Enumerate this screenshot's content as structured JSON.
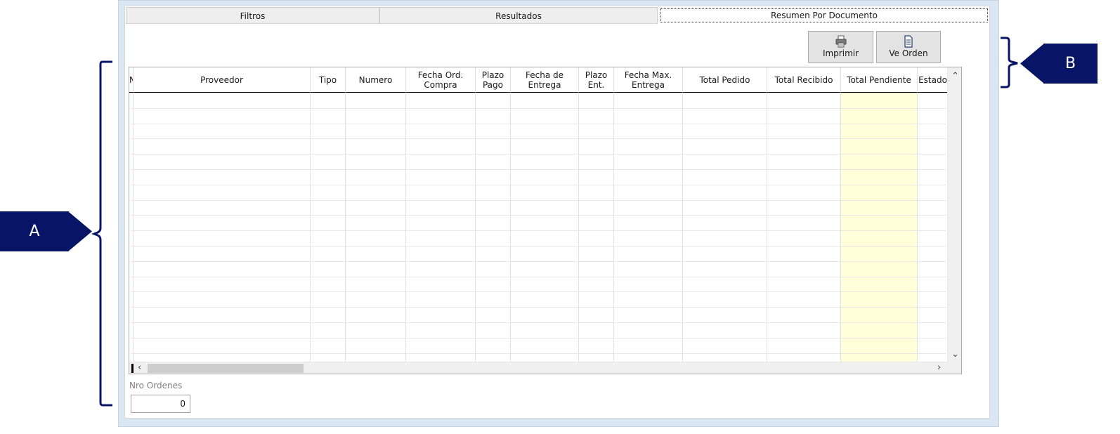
{
  "tabs": [
    {
      "label": "Filtros"
    },
    {
      "label": "Resultados"
    },
    {
      "label": "Resumen Por Documento"
    }
  ],
  "toolbar": {
    "print_label": "Imprimir",
    "view_order_label": "Ve Orden",
    "print_icon": "printer-icon",
    "view_order_icon": "document-icon"
  },
  "table": {
    "first_col_fragment": "N",
    "columns": [
      "Proveedor",
      "Tipo",
      "Numero",
      "Fecha Ord.\nCompra",
      "Plazo\nPago",
      "Fecha de\nEntrega",
      "Plazo\nEnt.",
      "Fecha  Max.\nEntrega",
      "Total Pedido",
      "Total Recibido",
      "Total Pendiente",
      "Estado"
    ],
    "highlight_column": "Total Pendiente",
    "highlight_color": "#ffffd9"
  },
  "footer": {
    "orders_label": "Nro Ordenes",
    "orders_value": "0"
  },
  "callouts": {
    "a": "A",
    "b": "B",
    "color": "#081567"
  }
}
